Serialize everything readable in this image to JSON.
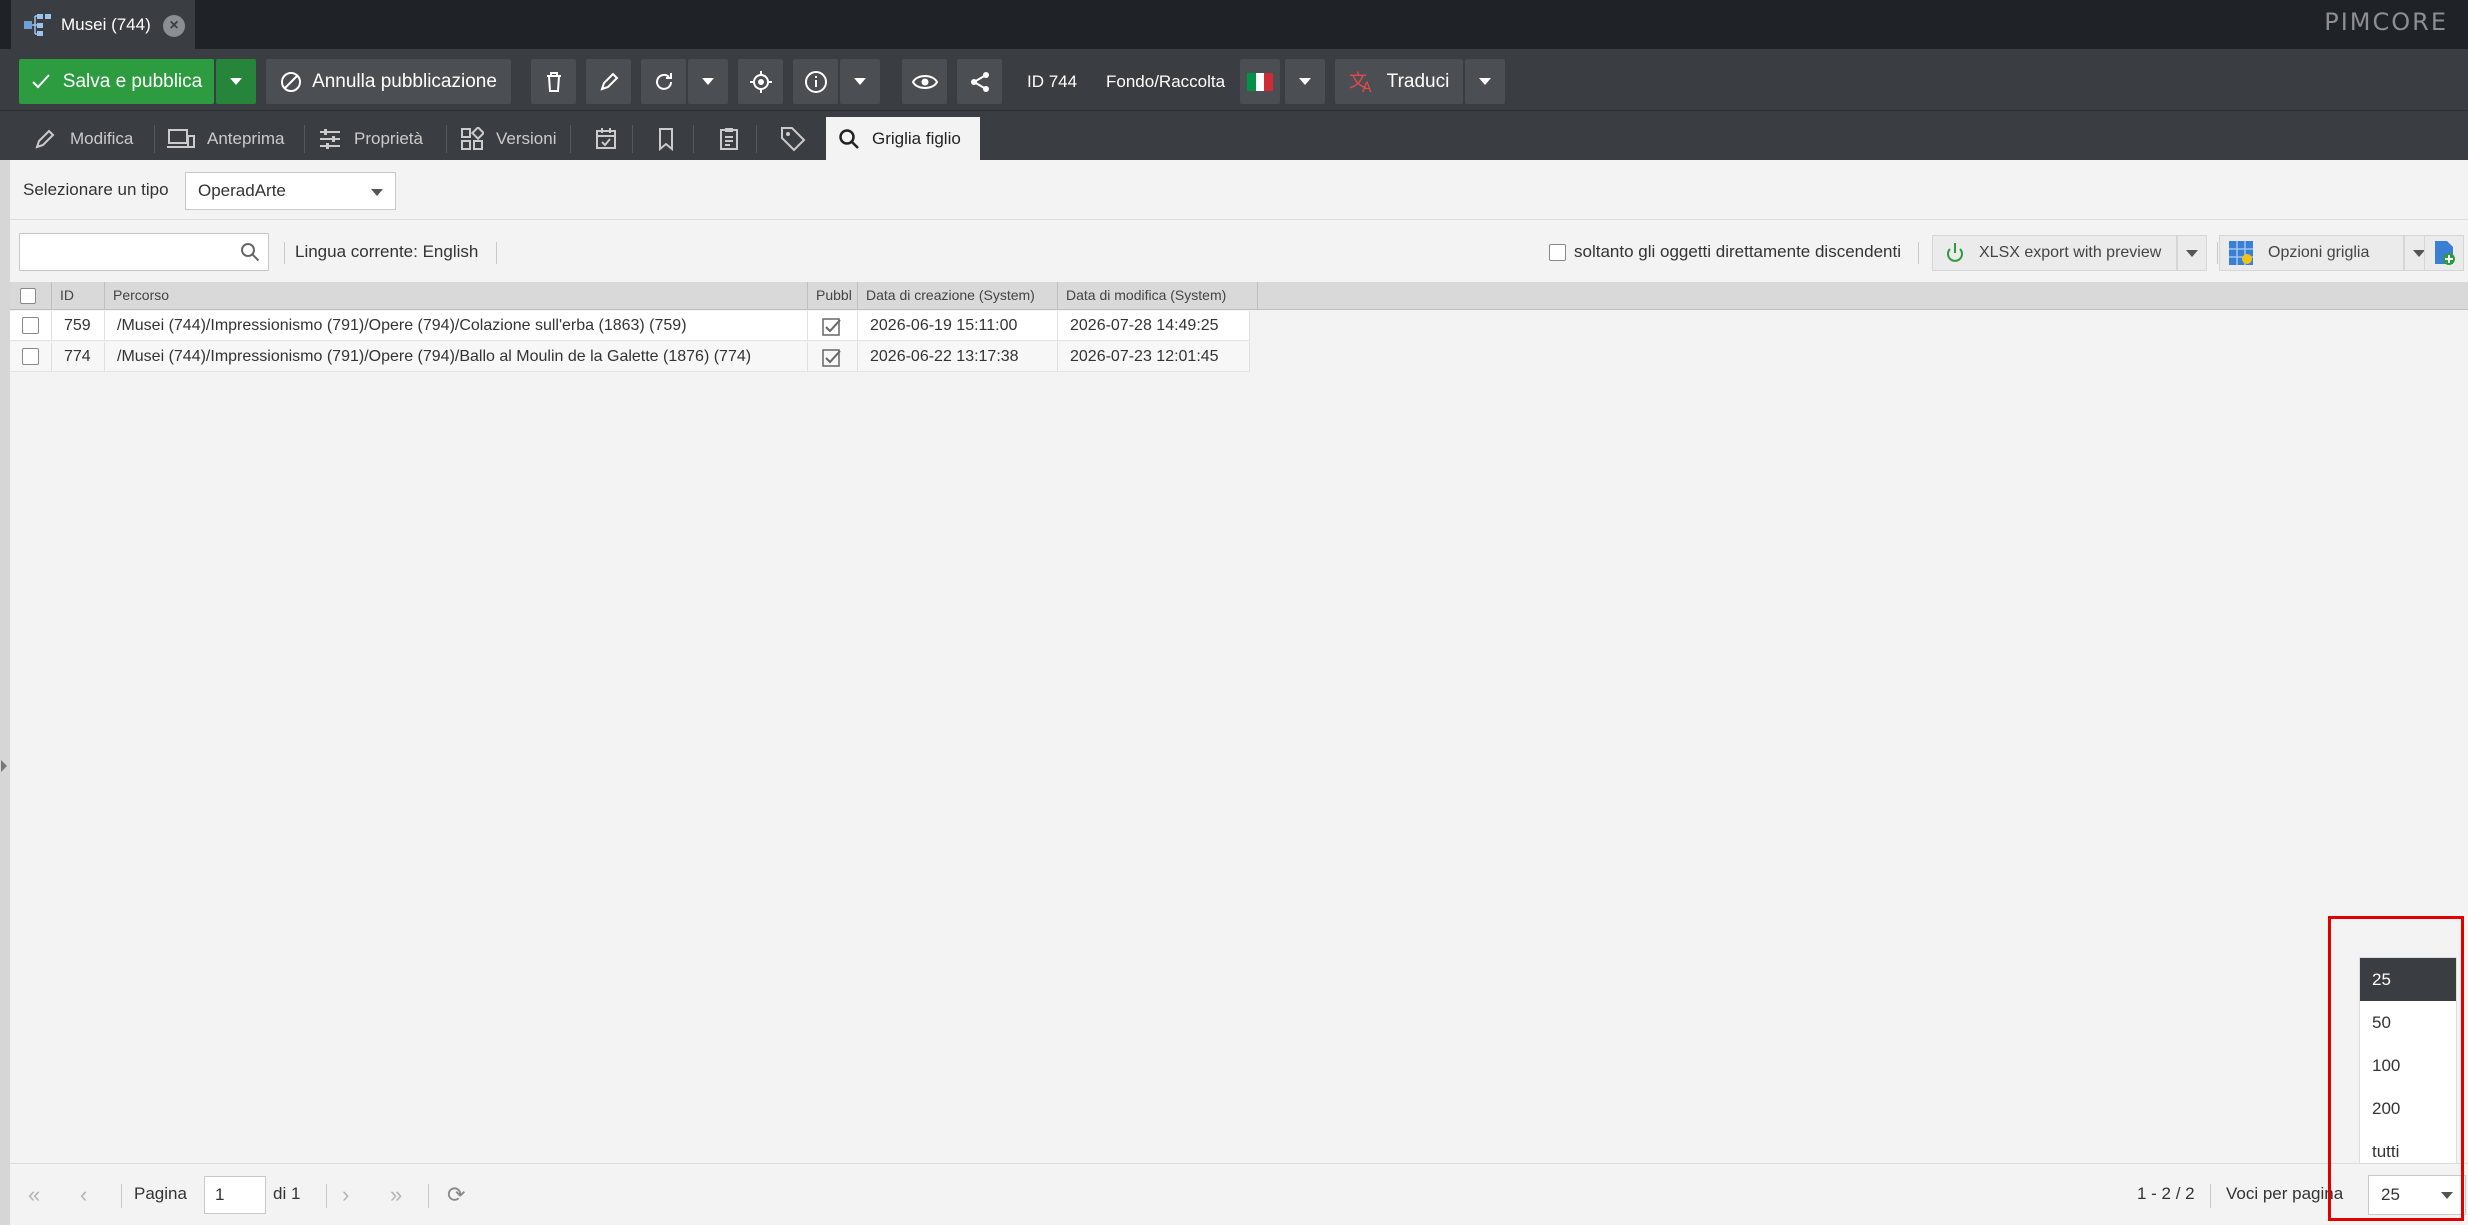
{
  "tab": {
    "title": "Musei (744)",
    "brand": "PIMCORE"
  },
  "toolbar": {
    "save_publish": "Salva e pubblica",
    "unpublish": "Annulla pubblicazione",
    "id_label": "ID 744",
    "type_label": "Fondo/Raccolta",
    "translate": "Traduci",
    "flag": "it"
  },
  "subtabs": [
    {
      "label": "Modifica",
      "icon": "pencil-icon"
    },
    {
      "label": "Anteprima",
      "icon": "devices-icon"
    },
    {
      "label": "Proprietà",
      "icon": "sliders-icon"
    },
    {
      "label": "Versioni",
      "icon": "versions-icon"
    },
    {
      "label": "",
      "icon": "calendar-check-icon"
    },
    {
      "label": "",
      "icon": "bookmark-icon"
    },
    {
      "label": "",
      "icon": "clipboard-icon"
    },
    {
      "label": "",
      "icon": "tag-icon"
    },
    {
      "label": "Griglia figlio",
      "icon": "search-icon"
    }
  ],
  "type_select": {
    "label": "Selezionare un tipo",
    "value": "OperadArte"
  },
  "grid_toolbar": {
    "search_value": "",
    "language": "Lingua corrente: English",
    "only_direct": "soltanto gli oggetti direttamente discendenti",
    "export": "XLSX export with preview",
    "options": "Opzioni griglia"
  },
  "grid": {
    "columns": [
      "ID",
      "Percorso",
      "Pubbl",
      "Data di creazione (System)",
      "Data di modifica (System)"
    ],
    "rows": [
      {
        "id": "759",
        "path": "/Musei (744)/Impressionismo (791)/Opere (794)/Colazione sull'erba (1863) (759)",
        "published": true,
        "created": "2026-06-19 15:11:00",
        "modified": "2026-07-28 14:49:25"
      },
      {
        "id": "774",
        "path": "/Musei (744)/Impressionismo (791)/Opere (794)/Ballo al Moulin de la Galette (1876) (774)",
        "published": true,
        "created": "2026-06-22 13:17:38",
        "modified": "2026-07-23 12:01:45"
      }
    ]
  },
  "pager": {
    "page_label": "Pagina",
    "page_value": "1",
    "of_label": "di 1",
    "range": "1 - 2 / 2",
    "per_page_label": "Voci per pagina",
    "per_page_value": "25",
    "options": [
      "25",
      "50",
      "100",
      "200",
      "tutti"
    ],
    "selected_option": "25"
  },
  "colors": {
    "accent_green": "#2d9b3f",
    "dark": "#3a3d41",
    "highlight": "#e00000"
  }
}
